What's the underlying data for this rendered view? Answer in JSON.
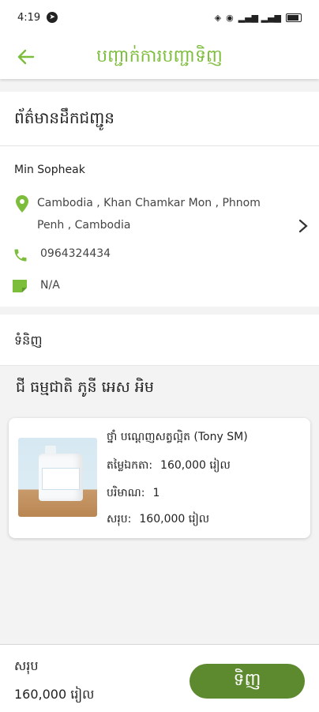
{
  "status_bar": {
    "time": "4:19",
    "signal_text": "▂▄▆ ▂▄▆"
  },
  "header": {
    "title": "បញ្ជាក់ការបញ្ជាទិញ"
  },
  "delivery": {
    "section_title": "ព័ត៌មានដឹកជញ្ជូន",
    "name": "Min Sopheak",
    "address": "Cambodia , Khan Chamkar Mon , Phnom Penh , Cambodia",
    "phone": "0964324434",
    "note": "N/A"
  },
  "items": {
    "section_title": "ទំនិញ",
    "shop_name": "ជី ធម្មជាតិ ភូនី អេស អិម",
    "product": {
      "name": "ថ្នាំ បណ្ដេញសត្វល្អិត (Tony SM)",
      "unit_price_label": "តម្លៃឯកតា:",
      "unit_price": "160,000 រៀល",
      "quantity_label": "បរិមាណ:",
      "quantity": "1",
      "subtotal_label": "សរុប:",
      "subtotal": "160,000 រៀល"
    }
  },
  "footer": {
    "total_label": "សរុប",
    "total_value": "160,000 រៀល",
    "buy_label": "ទិញ"
  },
  "colors": {
    "accent": "#7dbd3c",
    "button": "#5d8a2e"
  }
}
